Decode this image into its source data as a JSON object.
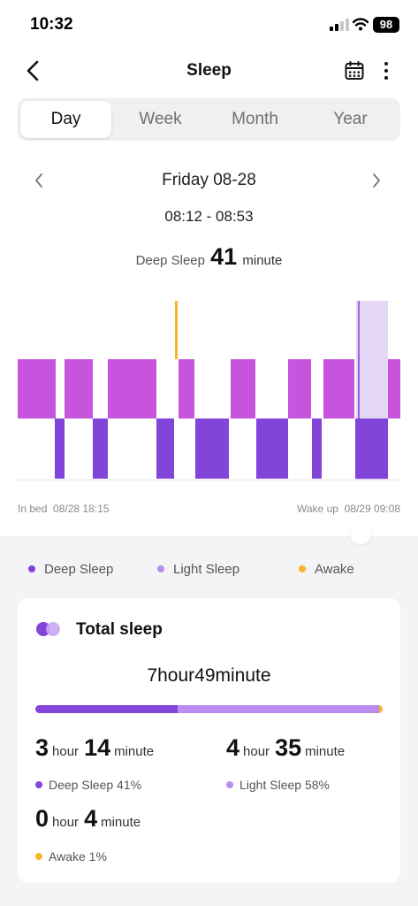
{
  "status_bar": {
    "time": "10:32",
    "battery": "98"
  },
  "nav": {
    "title": "Sleep",
    "back_icon": "chevron-left-icon",
    "calendar_icon": "calendar-icon",
    "more_icon": "more-vertical-icon"
  },
  "tabs": [
    {
      "label": "Day",
      "active": true
    },
    {
      "label": "Week",
      "active": false
    },
    {
      "label": "Month",
      "active": false
    },
    {
      "label": "Year",
      "active": false
    }
  ],
  "date_nav": {
    "date": "Friday 08-28",
    "prev_icon": "chevron-left-icon",
    "next_icon": "chevron-right-icon"
  },
  "summary": {
    "time_range": "08:12 - 08:53",
    "deep_label": "Deep Sleep",
    "deep_value": "41",
    "deep_unit": "minute"
  },
  "timeline": {
    "in_bed_label": "In bed",
    "in_bed_time": "08/28 18:15",
    "wake_label": "Wake up",
    "wake_time": "08/29 09:08"
  },
  "colors": {
    "deep": "#8244d9",
    "light": "#c654dc",
    "light_legend": "#b98df0",
    "awake": "#f5b62b",
    "highlight": "#e5d7f6"
  },
  "legend": [
    {
      "label": "Deep Sleep",
      "color": "#8244d9"
    },
    {
      "label": "Light Sleep",
      "color": "#b98df0"
    },
    {
      "label": "Awake",
      "color": "#f5b62b"
    }
  ],
  "total": {
    "title": "Total sleep",
    "icon": "sleep-rings-icon",
    "value": "7hour49minute",
    "bar_fractions": {
      "deep": 0.41,
      "light": 0.58,
      "awake": 0.01
    },
    "deep": {
      "h": "3",
      "h_unit": "hour",
      "m": "14",
      "m_unit": "minute",
      "label": "Deep Sleep 41%"
    },
    "light": {
      "h": "4",
      "h_unit": "hour",
      "m": "35",
      "m_unit": "minute",
      "label": "Light Sleep 58%"
    },
    "awake": {
      "h": "0",
      "h_unit": "hour",
      "m": "4",
      "m_unit": "minute",
      "label": "Awake 1%"
    }
  }
}
